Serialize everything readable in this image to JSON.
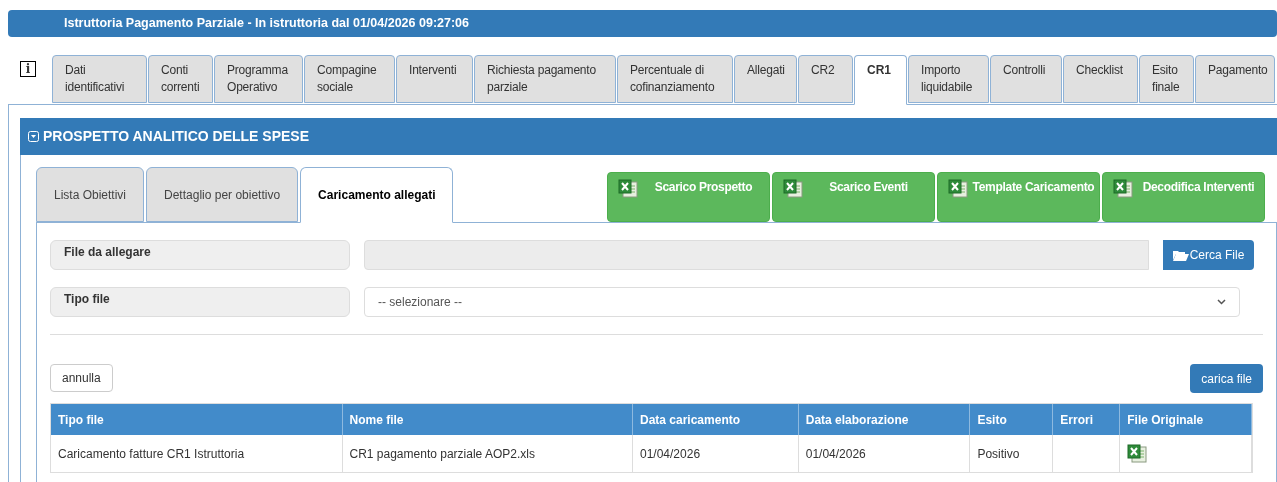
{
  "header": {
    "title": "Istruttoria Pagamento Parziale - In istruttoria dal 01/04/2026 09:27:06",
    "info_icon": "i"
  },
  "tabs": [
    {
      "label": "Dati identificativi",
      "selected": false
    },
    {
      "label": "Conti correnti",
      "selected": false
    },
    {
      "label": "Programma Operativo",
      "selected": false
    },
    {
      "label": "Compagine sociale",
      "selected": false
    },
    {
      "label": "Interventi",
      "selected": false
    },
    {
      "label": "Richiesta pagamento parziale",
      "selected": false
    },
    {
      "label": "Percentuale di cofinanziamento",
      "selected": false
    },
    {
      "label": "Allegati",
      "selected": false
    },
    {
      "label": "CR2",
      "selected": false
    },
    {
      "label": "CR1",
      "selected": true
    },
    {
      "label": "Importo liquidabile",
      "selected": false
    },
    {
      "label": "Controlli",
      "selected": false
    },
    {
      "label": "Checklist",
      "selected": false
    },
    {
      "label": "Esito finale",
      "selected": false
    },
    {
      "label": "Pagamento",
      "selected": false
    }
  ],
  "panel": {
    "title": "PROSPETTO ANALITICO DELLE SPESE",
    "expanded": true,
    "subtabs": [
      {
        "label": "Lista Obiettivi",
        "selected": false
      },
      {
        "label": "Dettaglio per obiettivo",
        "selected": false
      },
      {
        "label": "Caricamento allegati",
        "selected": true
      }
    ],
    "export_buttons": [
      "Scarico Prospetto",
      "Scarico Eventi",
      "Template Caricamento",
      "Decodifica Interventi"
    ],
    "form": {
      "file_label": "File da allegare",
      "browse_button": "Cerca File",
      "type_label": "Tipo file",
      "type_select": {
        "value": "-- selezionare --"
      }
    },
    "cancel_button": "annulla",
    "upload_button": "carica file",
    "table": {
      "columns": [
        "Tipo file",
        "Nome file",
        "Data caricamento",
        "Data elaborazione",
        "Esito",
        "Errori",
        "File Originale"
      ],
      "rows": [
        {
          "cells": [
            "Caricamento fatture CR1 Istruttoria",
            "CR1 pagamento parziale AOP2.xls",
            "01/04/2026",
            "01/04/2026",
            "Positivo",
            ""
          ],
          "has_file": true
        }
      ]
    }
  }
}
